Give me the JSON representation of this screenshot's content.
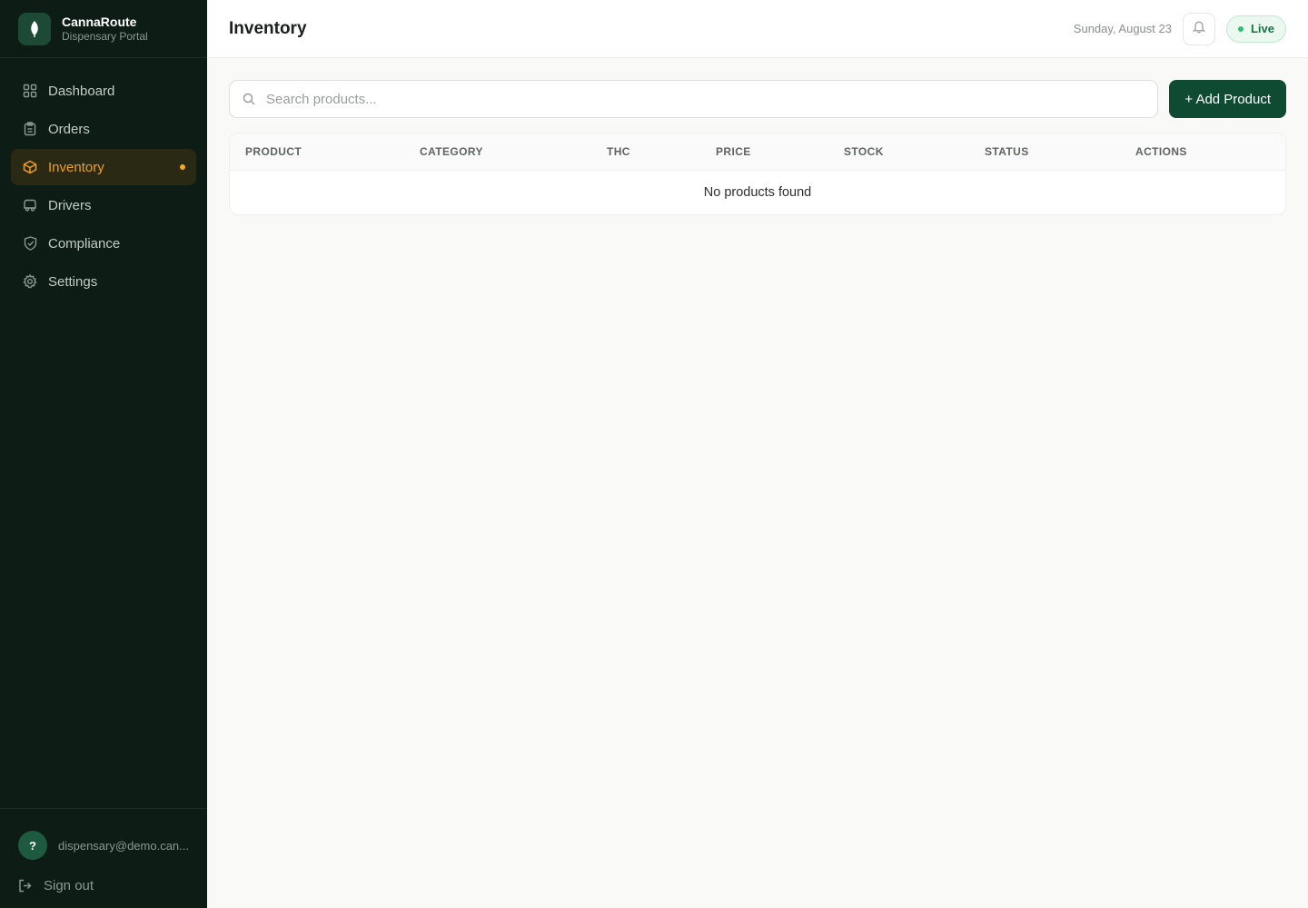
{
  "brand": {
    "name": "CannaRoute",
    "subtitle": "Dispensary Portal"
  },
  "sidebar": {
    "items": [
      {
        "label": "Dashboard",
        "icon": "grid-icon",
        "active": false
      },
      {
        "label": "Orders",
        "icon": "clipboard-icon",
        "active": false
      },
      {
        "label": "Inventory",
        "icon": "box-icon",
        "active": true
      },
      {
        "label": "Drivers",
        "icon": "car-icon",
        "active": false
      },
      {
        "label": "Compliance",
        "icon": "shield-icon",
        "active": false
      },
      {
        "label": "Settings",
        "icon": "gear-icon",
        "active": false
      }
    ],
    "user": {
      "avatar": "?",
      "email": "dispensary@demo.can..."
    },
    "signout_label": "Sign out"
  },
  "header": {
    "title": "Inventory",
    "date": "Sunday, August 23",
    "live_label": "Live"
  },
  "toolbar": {
    "search_placeholder": "Search products...",
    "add_label": "+ Add Product"
  },
  "table": {
    "columns": [
      "PRODUCT",
      "CATEGORY",
      "THC",
      "PRICE",
      "STOCK",
      "STATUS",
      "ACTIONS"
    ],
    "empty_message": "No products found"
  },
  "colors": {
    "sidebar_bg": "#0d1c14",
    "accent": "#f5a623",
    "primary_button": "#0f4a33",
    "live_green": "#2fbf71"
  }
}
